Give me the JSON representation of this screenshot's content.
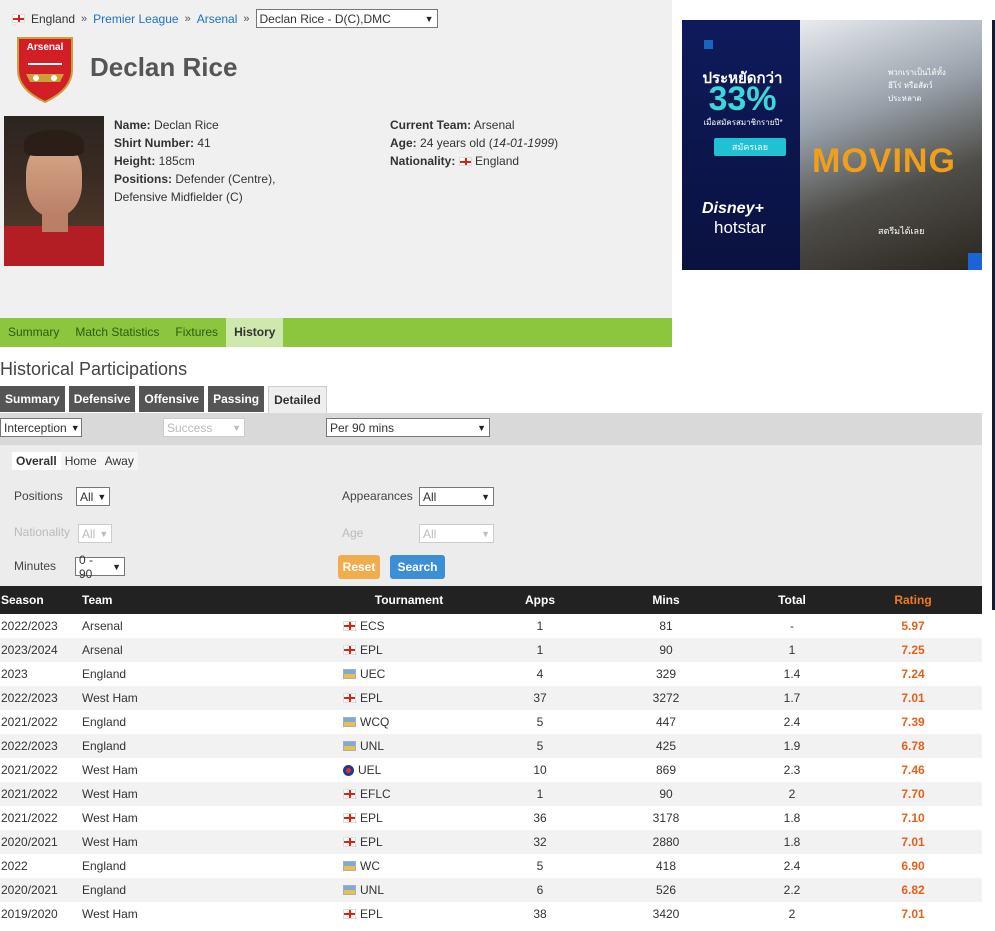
{
  "breadcrumb": {
    "country": "England",
    "league": "Premier League",
    "team": "Arsenal",
    "selected_player": "Declan Rice - D(C),DMC"
  },
  "player": {
    "name": "Declan Rice",
    "details": {
      "name_label": "Name:",
      "name_value": "Declan Rice",
      "shirt_label": "Shirt Number:",
      "shirt_value": "41",
      "height_label": "Height:",
      "height_value": "185cm",
      "positions_label": "Positions:",
      "positions_value_1": "Defender (Centre),",
      "positions_value_2": "Defensive Midfielder (C)",
      "team_label": "Current Team:",
      "team_value": "Arsenal",
      "age_label": "Age:",
      "age_value": "24 years old (",
      "dob": "14-01-1999",
      "age_close": ")",
      "nationality_label": "Nationality:",
      "nationality_value": "England"
    },
    "crest_text": "Arsenal"
  },
  "nav": {
    "items": [
      "Summary",
      "Match Statistics",
      "Fixtures",
      "History"
    ],
    "active": "History"
  },
  "ad": {
    "save_text": "ประหยัดกว่า",
    "percent": "33%",
    "sub_text": "เมื่อสมัครสมาชิกรายปี*",
    "cta": "สมัครเลย",
    "logo_line1": "Disney+",
    "logo_line2": "hotstar",
    "show_title": "MOVING",
    "watch_text": "สตรีมได้เลย",
    "tagline": "พวกเราเป็นได้ทั้งฮีโร่ หรือสัตว์ประหลาด"
  },
  "history": {
    "title": "Historical Participations",
    "tabs": [
      "Summary",
      "Defensive",
      "Offensive",
      "Passing",
      "Detailed"
    ],
    "active_tab": "Detailed",
    "filters": {
      "category": "Interception",
      "subcategory": "Success",
      "accumulation": "Per 90 mins",
      "venue": [
        "Overall",
        "Home",
        "Away"
      ],
      "venue_active": "Overall",
      "positions_label": "Positions",
      "positions_value": "All",
      "appearances_label": "Appearances",
      "appearances_value": "All",
      "nationality_label": "Nationality",
      "nationality_value": "All",
      "age_label": "Age",
      "age_value": "All",
      "minutes_label": "Minutes",
      "minutes_value": "0 - 90",
      "reset_label": "Reset",
      "search_label": "Search"
    },
    "columns": [
      "Season",
      "Team",
      "Tournament",
      "Apps",
      "Mins",
      "Total",
      "Rating"
    ],
    "rows": [
      {
        "season": "2022/2023",
        "team": "Arsenal",
        "icon": "england-flag-icon",
        "tournament": "ECS",
        "apps": "1",
        "mins": "81",
        "total": "-",
        "rating": "5.97"
      },
      {
        "season": "2023/2024",
        "team": "Arsenal",
        "icon": "england-flag-icon",
        "tournament": "EPL",
        "apps": "1",
        "mins": "90",
        "total": "1",
        "rating": "7.25"
      },
      {
        "season": "2023",
        "team": "England",
        "icon": "fifa-icon",
        "tournament": "UEC",
        "apps": "4",
        "mins": "329",
        "total": "1.4",
        "rating": "7.24"
      },
      {
        "season": "2022/2023",
        "team": "West Ham",
        "icon": "england-flag-icon",
        "tournament": "EPL",
        "apps": "37",
        "mins": "3272",
        "total": "1.7",
        "rating": "7.01"
      },
      {
        "season": "2021/2022",
        "team": "England",
        "icon": "fifa-icon",
        "tournament": "WCQ",
        "apps": "5",
        "mins": "447",
        "total": "2.4",
        "rating": "7.39"
      },
      {
        "season": "2022/2023",
        "team": "England",
        "icon": "fifa-icon",
        "tournament": "UNL",
        "apps": "5",
        "mins": "425",
        "total": "1.9",
        "rating": "6.78"
      },
      {
        "season": "2021/2022",
        "team": "West Ham",
        "icon": "uefa-icon",
        "tournament": "UEL",
        "apps": "10",
        "mins": "869",
        "total": "2.3",
        "rating": "7.46"
      },
      {
        "season": "2021/2022",
        "team": "West Ham",
        "icon": "england-flag-icon",
        "tournament": "EFLC",
        "apps": "1",
        "mins": "90",
        "total": "2",
        "rating": "7.70"
      },
      {
        "season": "2021/2022",
        "team": "West Ham",
        "icon": "england-flag-icon",
        "tournament": "EPL",
        "apps": "36",
        "mins": "3178",
        "total": "1.8",
        "rating": "7.10"
      },
      {
        "season": "2020/2021",
        "team": "West Ham",
        "icon": "england-flag-icon",
        "tournament": "EPL",
        "apps": "32",
        "mins": "2880",
        "total": "1.8",
        "rating": "7.01"
      },
      {
        "season": "2022",
        "team": "England",
        "icon": "fifa-icon",
        "tournament": "WC",
        "apps": "5",
        "mins": "418",
        "total": "2.4",
        "rating": "6.90"
      },
      {
        "season": "2020/2021",
        "team": "England",
        "icon": "fifa-icon",
        "tournament": "UNL",
        "apps": "6",
        "mins": "526",
        "total": "2.2",
        "rating": "6.82"
      },
      {
        "season": "2019/2020",
        "team": "West Ham",
        "icon": "england-flag-icon",
        "tournament": "EPL",
        "apps": "38",
        "mins": "3420",
        "total": "2",
        "rating": "7.01"
      }
    ]
  },
  "colors": {
    "nav_green": "#8cc63e",
    "rating_orange": "#e4611a",
    "link_blue": "#1b73c2",
    "reset_orange": "#f0ad4e",
    "search_blue": "#3c8fd4"
  }
}
